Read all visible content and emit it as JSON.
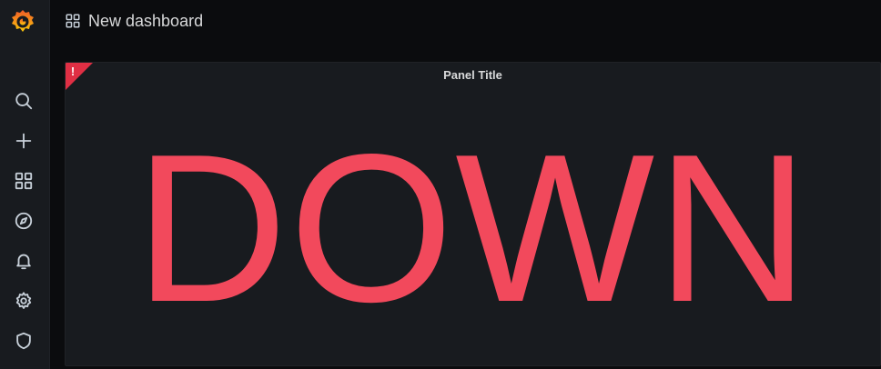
{
  "colors": {
    "status": "#f2495c",
    "sidebar": "#181b1f",
    "background": "#0b0c0e",
    "brand_gradient": [
      "#f05a28",
      "#fbca0a"
    ]
  },
  "sidebar": {
    "logo": "grafana-logo",
    "items": [
      {
        "icon": "search-icon"
      },
      {
        "icon": "plus-icon"
      },
      {
        "icon": "dashboards-icon"
      },
      {
        "icon": "compass-icon"
      },
      {
        "icon": "bell-icon"
      },
      {
        "icon": "gear-icon"
      },
      {
        "icon": "shield-icon"
      }
    ]
  },
  "header": {
    "icon": "dashboards-icon",
    "title": "New dashboard"
  },
  "panel": {
    "title": "Panel Title",
    "value": "DOWN",
    "error_indicator": "!"
  }
}
